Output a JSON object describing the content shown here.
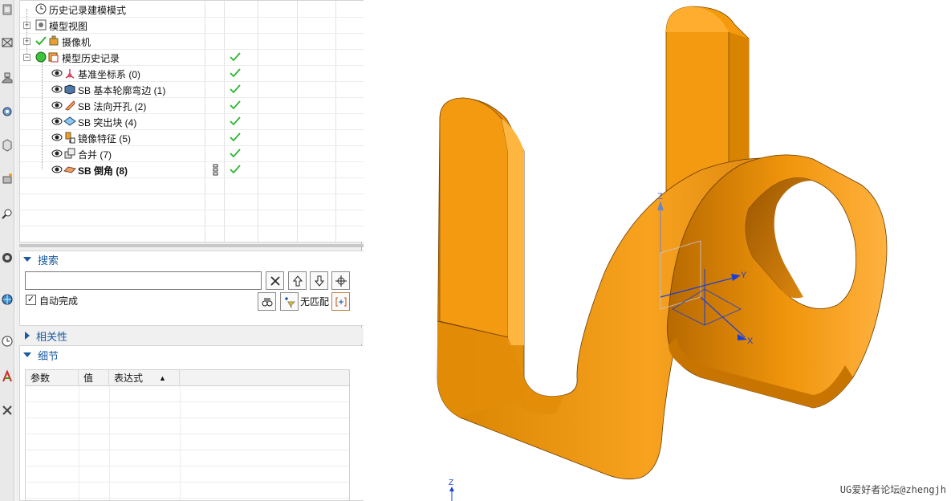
{
  "tree": {
    "rows": [
      {
        "label": "历史记录建模模式",
        "icon": "clock-icon",
        "expander": "",
        "checked": false,
        "bold": false
      },
      {
        "label": "模型视图",
        "icon": "model-view-icon",
        "expander": "+",
        "checked": false,
        "bold": false
      },
      {
        "label": "摄像机",
        "icon": "camera-icon",
        "expander": "+",
        "checked": false,
        "bold": false
      },
      {
        "label": "模型历史记录",
        "icon": "history-icon",
        "expander": "−",
        "checked": true,
        "bold": false
      },
      {
        "label": "基准坐标系 (0)",
        "icon": "datum-csys-icon",
        "expander": "",
        "checked": true,
        "bold": false
      },
      {
        "label": "SB 基本轮廓弯边 (1)",
        "icon": "contour-flange-icon",
        "expander": "",
        "checked": true,
        "bold": false
      },
      {
        "label": "SB 法向开孔 (2)",
        "icon": "normal-cutout-icon",
        "expander": "",
        "checked": true,
        "bold": false
      },
      {
        "label": "SB 突出块 (4)",
        "icon": "tab-icon",
        "expander": "",
        "checked": true,
        "bold": false
      },
      {
        "label": "镜像特征 (5)",
        "icon": "mirror-feature-icon",
        "expander": "",
        "checked": true,
        "bold": false
      },
      {
        "label": "合并 (7)",
        "icon": "unite-icon",
        "expander": "",
        "checked": true,
        "bold": false
      },
      {
        "label": "SB 倒角 (8)",
        "icon": "chamfer-icon",
        "expander": "",
        "checked": true,
        "bold": true
      }
    ]
  },
  "search": {
    "title": "搜索",
    "value": "",
    "placeholder": "",
    "autocomplete_label": "自动完成",
    "autocomplete_checked": true,
    "no_match_label": "无匹配"
  },
  "dependencies": {
    "title": "相关性"
  },
  "details": {
    "title": "细节",
    "columns": [
      "参数",
      "值",
      "表达式"
    ],
    "sort_indicator": "▲"
  },
  "viewport": {
    "axis_x": "X",
    "axis_y": "Y",
    "axis_z": "Z",
    "triad_z": "Z",
    "watermark": "UG爱好者论坛@zhengjh",
    "part_color": "#F59A0C",
    "part_shade": "#C47200",
    "part_light": "#FFB640",
    "axis_color": "#1A3FD8",
    "check_color": "#2DB52D"
  }
}
